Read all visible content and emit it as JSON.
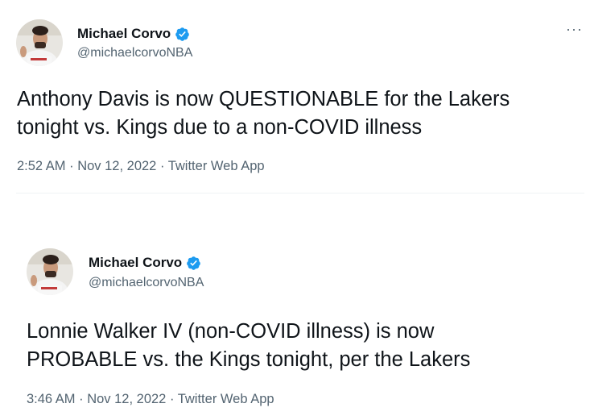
{
  "tweets": [
    {
      "author_name": "Michael Corvo",
      "handle": "@michaelcorvoNBA",
      "more_icon": "···",
      "line1": "Anthony Davis is now QUESTIONABLE for the Lakers",
      "line2": "tonight vs. Kings due to a non-COVID illness",
      "meta": "2:52 AM · Nov 12, 2022 · Twitter Web App"
    },
    {
      "author_name": "Michael Corvo",
      "handle": "@michaelcorvoNBA",
      "line1": "Lonnie Walker IV (non-COVID illness) is now",
      "line2": "PROBABLE vs. the Kings tonight, per the Lakers",
      "meta": "3:46 AM · Nov 12, 2022 · Twitter Web App"
    }
  ],
  "colors": {
    "text_primary": "#0f1419",
    "text_secondary": "#536471",
    "verified_badge": "#1d9bf0",
    "divider": "#eff3f4"
  },
  "icons": {
    "verified": "verified-badge-icon",
    "more": "more-options-icon"
  }
}
